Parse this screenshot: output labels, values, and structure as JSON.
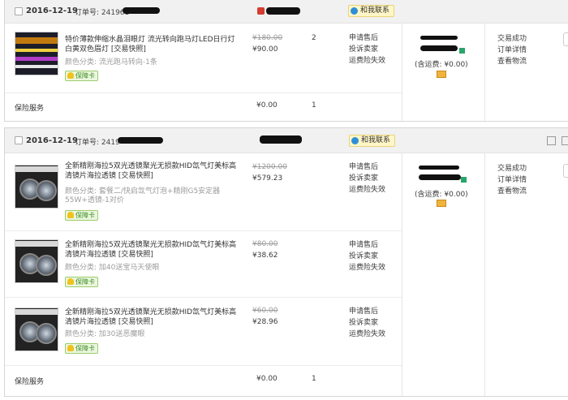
{
  "order1": {
    "date": "2016-12-19",
    "order_no_label": "订单号: 241961",
    "wangwang": "和我联系",
    "item": {
      "title": "特价薄款伸缩水晶泪眼灯 流光转向跑马灯LED日行灯 白黄双色眉灯 [交易快照]",
      "attr": "颜色分类: 流光跑马转向-1条",
      "badge": "保障卡",
      "price_old": "¥180.00",
      "price_new": "¥90.00",
      "qty": "2",
      "service": [
        "申请售后",
        "投诉卖家",
        "运费险失效"
      ]
    },
    "total": {
      "shipping": "(含运费: ¥0.00)"
    },
    "status": [
      "交易成功",
      "订单详情",
      "查看物流"
    ],
    "insurance": {
      "label": "保险服务",
      "price": "¥0.00",
      "qty": "1"
    }
  },
  "order2": {
    "date": "2016-12-19",
    "order_no_label": "订单号: 2419",
    "wangwang": "和我联系",
    "items": [
      {
        "title": "全新精刚海拉5双光透镜聚光无损款HID氙气灯美标高清镜片海拉透镜 [交易快照]",
        "attr": "颜色分类: 套餐二/快启氙气灯泡+精刚G5安定器55W+透镜-1对价",
        "badge": "保障卡",
        "price_old": "¥1200.00",
        "price_new": "¥579.23",
        "service": [
          "申请售后",
          "投诉卖家",
          "运费险失效"
        ]
      },
      {
        "title": "全新精刚海拉5双光透镜聚光无损款HID氙气灯美标高清镜片海拉透镜 [交易快照]",
        "attr": "颜色分类: 加40送宝马天使眼",
        "badge": "保障卡",
        "price_old": "¥80.00",
        "price_new": "¥38.62",
        "service": [
          "申请售后",
          "投诉卖家",
          "运费险失效"
        ]
      },
      {
        "title": "全新精刚海拉5双光透镜聚光无损款HID氙气灯美标高清镜片海拉透镜 [交易快照]",
        "attr": "颜色分类: 加30送恶魔眼",
        "badge": "保障卡",
        "price_old": "¥60.00",
        "price_new": "¥28.96",
        "service": [
          "申请售后",
          "投诉卖家",
          "运费险失效"
        ]
      }
    ],
    "total": {
      "shipping": "(含运费: ¥0.00)"
    },
    "status": [
      "交易成功",
      "订单详情",
      "查看物流"
    ],
    "insurance": {
      "label": "保险服务",
      "price": "¥0.00",
      "qty": "1"
    }
  }
}
